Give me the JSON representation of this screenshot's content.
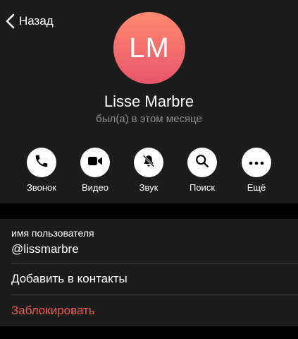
{
  "nav": {
    "back_label": "Назад"
  },
  "profile": {
    "initials": "LM",
    "name": "Lisse Marbre",
    "status": "был(а) в этом месяце",
    "avatar_gradient": [
      "#ff8a6f",
      "#e8566b"
    ]
  },
  "actions": [
    {
      "label": "Звонок",
      "icon": "phone-icon"
    },
    {
      "label": "Видео",
      "icon": "video-camera-icon"
    },
    {
      "label": "Звук",
      "icon": "bell-muted-icon"
    },
    {
      "label": "Поиск",
      "icon": "search-icon"
    },
    {
      "label": "Ещё",
      "icon": "more-icon"
    }
  ],
  "info": {
    "username_caption": "имя пользователя",
    "username_value": "@lissmarbre",
    "add_contact": "Добавить в контакты",
    "block": "Заблокировать"
  },
  "colors": {
    "background": "#000000",
    "panel": "#1c1c1d",
    "danger": "#ef5b4f",
    "secondary_text": "#8e8e93"
  }
}
